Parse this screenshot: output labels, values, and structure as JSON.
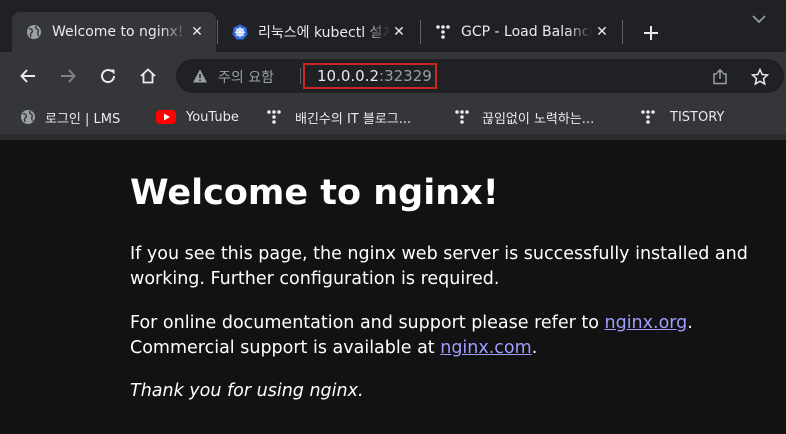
{
  "tabs": [
    {
      "title": "Welcome to nginx!",
      "icon": "globe-icon",
      "active": true
    },
    {
      "title": "리눅스에 kubectl 설치 및 설정",
      "icon": "kubernetes-icon",
      "active": false
    },
    {
      "title": "GCP - Load Balancing",
      "icon": "tistory-icon",
      "active": false
    }
  ],
  "toolbar": {
    "security_label": "주의 요함",
    "url_host": "10.0.0.2",
    "url_port": ":32329"
  },
  "bookmarks": [
    {
      "label": "로그인 | LMS",
      "icon": "globe-icon"
    },
    {
      "label": "YouTube",
      "icon": "youtube-icon"
    },
    {
      "label": "배긴수의 IT 블로그...",
      "icon": "tistory-icon"
    },
    {
      "label": "끊임없이 노력하는...",
      "icon": "tistory-icon"
    },
    {
      "label": "TISTORY",
      "icon": "tistory-icon"
    }
  ],
  "page": {
    "heading": "Welcome to nginx!",
    "p1_line1": "If you see this page, the nginx web server is successfully installed and",
    "p1_line2": "working. Further configuration is required.",
    "p2_line1_prefix": "For online documentation and support please refer to ",
    "p2_link1": "nginx.org",
    "p2_line1_suffix": ".",
    "p2_line2_prefix": "Commercial support is available at ",
    "p2_link2": "nginx.com",
    "p2_line2_suffix": ".",
    "thanks": "Thank you for using nginx."
  },
  "colors": {
    "tabstrip": "#202124",
    "toolbar": "#35363a",
    "omnibox": "#202124",
    "page_bg": "#121212",
    "link": "#9e9eff",
    "highlight_box": "#c62828"
  }
}
